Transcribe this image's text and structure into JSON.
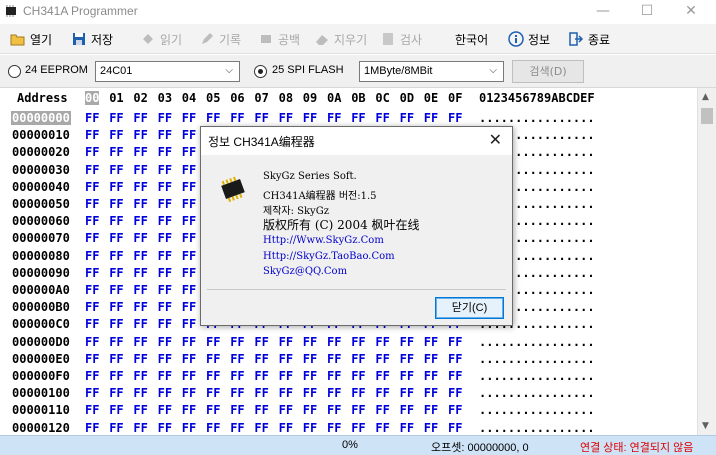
{
  "window": {
    "title": "CH341A Programmer",
    "controls": [
      "—",
      "☐",
      "✕"
    ]
  },
  "toolbar": {
    "items": [
      {
        "label": "열기",
        "icon": "open-folder-icon",
        "enabled": true
      },
      {
        "label": "저장",
        "icon": "save-disk-icon",
        "enabled": true
      },
      {
        "label": "읽기",
        "icon": "read-chip-icon",
        "enabled": false
      },
      {
        "label": "기록",
        "icon": "write-icon",
        "enabled": false
      },
      {
        "label": "공백",
        "icon": "blank-icon",
        "enabled": false
      },
      {
        "label": "지우기",
        "icon": "erase-icon",
        "enabled": false
      },
      {
        "label": "검사",
        "icon": "verify-icon",
        "enabled": false
      },
      {
        "label": "한국어",
        "icon": "",
        "enabled": true
      },
      {
        "label": "정보",
        "icon": "info-icon",
        "enabled": true
      },
      {
        "label": "종료",
        "icon": "exit-icon",
        "enabled": true
      }
    ]
  },
  "options": {
    "eeprom_label": "24 EEPROM",
    "eeprom_selected": false,
    "eeprom_model": "24C01",
    "spi_label": "25 SPI FLASH",
    "spi_selected": true,
    "spi_size": "1MByte/8MBit",
    "detect_button": "검색(D)"
  },
  "hex": {
    "address_header": "Address",
    "column_headers": [
      "00",
      "01",
      "02",
      "03",
      "04",
      "05",
      "06",
      "07",
      "08",
      "09",
      "0A",
      "0B",
      "0C",
      "0D",
      "0E",
      "0F"
    ],
    "ascii_header": "0123456789ABCDEF",
    "addresses": [
      "00000000",
      "00000010",
      "00000020",
      "00000030",
      "00000040",
      "00000050",
      "00000060",
      "00000070",
      "00000080",
      "00000090",
      "000000A0",
      "000000B0",
      "000000C0",
      "000000D0",
      "000000E0",
      "000000F0",
      "00000100",
      "00000110",
      "00000120"
    ],
    "byte_value": "FF",
    "ascii_row": "................"
  },
  "status": {
    "progress": "0%",
    "offset": "오프셋: 00000000, 0",
    "connection": "연결 상태: 연결되지 않음",
    "connection_color": "#dd0000"
  },
  "dialog": {
    "title": "정보 CH341A编程器",
    "lines": [
      "SkyGz Series Soft.",
      "CH341A编程器 버전:1.5",
      "제작자: SkyGz",
      "版权所有 (C) 2004 枫叶在线",
      "Http://Www.SkyGz.Com",
      "Http://SkyGz.TaoBao.Com",
      "SkyGz@QQ.Com"
    ],
    "close_button": "닫기(C)"
  }
}
